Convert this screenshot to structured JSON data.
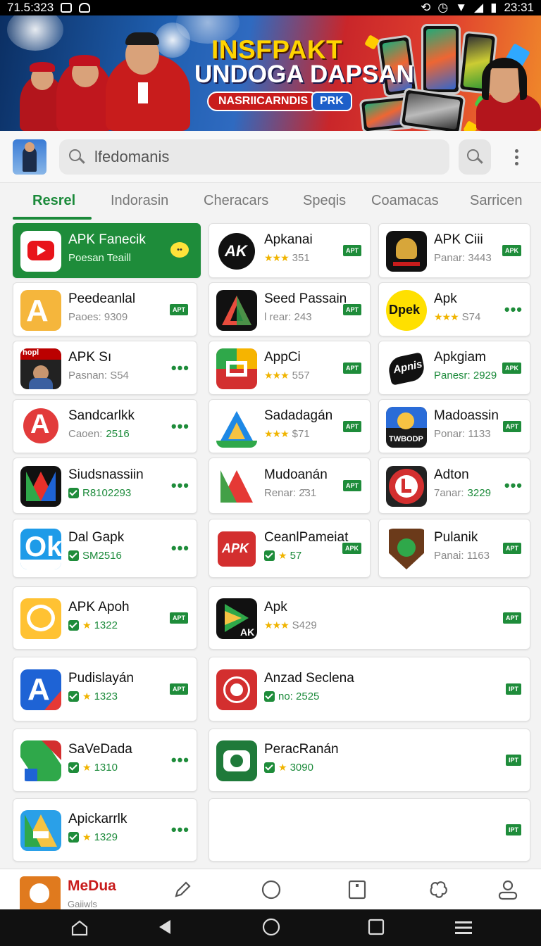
{
  "status_bar": {
    "time_left": "71.5:323",
    "time_right": "23:31"
  },
  "banner": {
    "title_line1": "INSFPAKT",
    "title_line2": "UNDOGA DAPSAN",
    "pill_label": "NASRIICARNDIS",
    "badge_label": "PRK"
  },
  "search": {
    "placeholder": "lfedomanis"
  },
  "tabs": [
    "Resrel",
    "Indorasin",
    "Cheracars",
    "Speqis",
    "Coamacas",
    "Sarricen"
  ],
  "apps": [
    {
      "name": "APK Fanecik",
      "sub": "Poesan Teaill",
      "meta": "",
      "badge": "",
      "featured": true
    },
    {
      "name": "Apkanai",
      "sub": "351",
      "meta": "stars",
      "badge": "APT"
    },
    {
      "name": "APK Ciii",
      "sub": "Panar: 3443",
      "meta": "",
      "badge": "APK"
    },
    {
      "name": "Peedeanlal",
      "sub": "Paoes: 9309",
      "meta": "",
      "badge": "APT"
    },
    {
      "name": "Seed Passain",
      "sub": "l rear: 243",
      "meta": "",
      "badge": "APT"
    },
    {
      "name": "Apk",
      "sub": "S74",
      "meta": "stars",
      "badge": "dots"
    },
    {
      "name": "APK Sı",
      "sub": "Pasnan: S54",
      "meta": "",
      "badge": "dots"
    },
    {
      "name": "AppCi",
      "sub": "557",
      "meta": "stars",
      "badge": "APT"
    },
    {
      "name": "Apkgiam",
      "sub": "Panesr: 2929",
      "meta": "green",
      "badge": "APK"
    },
    {
      "name": "Sandcarlkk",
      "sub": "2516",
      "prefix": "Caoen:",
      "meta": "green",
      "badge": "dots"
    },
    {
      "name": "Sadadagán",
      "sub": "$71",
      "meta": "stars",
      "badge": "APT"
    },
    {
      "name": "Madoassin",
      "sub": "Ponar: 1133",
      "meta": "",
      "badge": "APT"
    },
    {
      "name": "Siudsnassiin",
      "sub": "R8102293",
      "meta": "check",
      "badge": "dots"
    },
    {
      "name": "Mudoanán",
      "sub": "Renar: 2̄31",
      "meta": "",
      "badge": "APT"
    },
    {
      "name": "Adton",
      "sub": "3229",
      "prefix": "7anar:",
      "meta": "green",
      "badge": "dots"
    },
    {
      "name": "Dal Gapk",
      "sub": "SM2516",
      "meta": "check",
      "badge": "dots"
    },
    {
      "name": "CeanlPameiat",
      "sub": "57",
      "meta": "checkstar",
      "badge": "APK"
    },
    {
      "name": "Pulanik",
      "sub": "Panai: 1163",
      "meta": "",
      "badge": "APT"
    },
    {
      "name": "APK Apoh",
      "sub": "1322",
      "meta": "checkstar",
      "badge": "APT"
    },
    {
      "name": "Apk",
      "sub": "S429",
      "meta": "stars",
      "badge": "APT"
    },
    {
      "name": "Pudislayán",
      "sub": "1323",
      "meta": "checkstar",
      "badge": "APT"
    },
    {
      "name": "Anzad Seclena",
      "sub": "no: 2525",
      "meta": "check",
      "badge": "IPT"
    },
    {
      "name": "SaVeDada",
      "sub": "1310",
      "meta": "checkstar",
      "badge": "dots"
    },
    {
      "name": "PeracRanán",
      "sub": "3090",
      "meta": "checkstar",
      "badge": "IPT"
    },
    {
      "name": "Apickarrlk",
      "sub": "1329",
      "meta": "checkstar",
      "badge": "dots"
    },
    {
      "name": "",
      "sub": "",
      "meta": "",
      "badge": "IPT"
    }
  ],
  "bottom_nav": {
    "brand": "MeDua",
    "brand_sub": "Gaiiwls",
    "items": [
      "edit-icon",
      "circle-icon",
      "box-icon",
      "puzzle-icon",
      "profile-icon"
    ]
  },
  "system_nav": [
    "home-icon",
    "back-icon",
    "circle-home-icon",
    "recents-icon",
    "menu-icon"
  ],
  "colors": {
    "accent": "#1b8a3a",
    "featured": "#1e8c3a",
    "brand_red": "#c81c1c"
  }
}
